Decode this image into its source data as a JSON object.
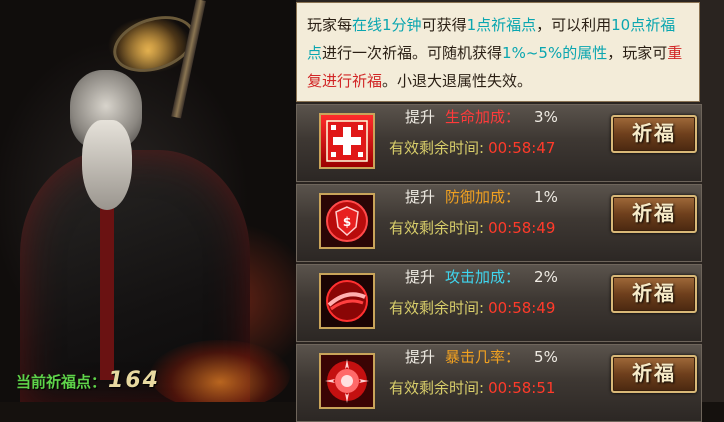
{
  "description": {
    "p1": "玩家每",
    "p2": "在线1分钟",
    "p3": "可获得",
    "p4": "1点祈福点",
    "p5": "，可以利用",
    "p6": "10点祈福点",
    "p7": "进行一次祈福。可随机获得",
    "p8": "1%~5%的属性",
    "p9": "，玩家可",
    "p10": "重复进行祈福",
    "p11": "。小退大退属性失效。"
  },
  "rows": [
    {
      "prefix": "提升",
      "stat": "生命加成：",
      "stat_color": "#ff3a3a",
      "value": "3%",
      "time_label": "有效剩余时间:",
      "time": "00:58:47",
      "button": "祈福",
      "icon": "health-cross-icon"
    },
    {
      "prefix": "提升",
      "stat": "防御加成：",
      "stat_color": "#f0a020",
      "value": "1%",
      "time_label": "有效剩余时间:",
      "time": "00:58:49",
      "button": "祈福",
      "icon": "defense-shield-icon"
    },
    {
      "prefix": "提升",
      "stat": "攻击加成：",
      "stat_color": "#3fd6ef",
      "value": "2%",
      "time_label": "有效剩余时间:",
      "time": "00:58:49",
      "button": "祈福",
      "icon": "attack-slash-icon"
    },
    {
      "prefix": "提升",
      "stat": "暴击几率：",
      "stat_color": "#f0a020",
      "value": "5%",
      "time_label": "有效剩余时间:",
      "time": "00:58:51",
      "button": "祈福",
      "icon": "critical-burst-icon"
    }
  ],
  "blessing_points": {
    "label": "当前祈福点：",
    "value": "164"
  }
}
